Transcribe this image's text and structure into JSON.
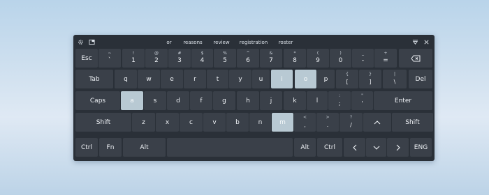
{
  "suggestions": [
    "or",
    "reasons",
    "review",
    "registration",
    "roster"
  ],
  "icons": [
    "settings-icon",
    "keyboard-layout-icon",
    "dock-icon",
    "close-icon",
    "backspace-icon",
    "arrow-up-icon",
    "arrow-left-icon",
    "arrow-down-icon",
    "arrow-right-icon"
  ],
  "colors": {
    "keyboard_bg": "#2a3038",
    "key": "#3a4049",
    "highlight": "#b8c9d3"
  },
  "rows": [
    [
      {
        "label": "Esc"
      },
      {
        "top": "~",
        "bottom": "`"
      },
      {
        "top": "!",
        "bottom": "1"
      },
      {
        "top": "@",
        "bottom": "2"
      },
      {
        "top": "#",
        "bottom": "3"
      },
      {
        "top": "$",
        "bottom": "4"
      },
      {
        "top": "%",
        "bottom": "5"
      },
      {
        "top": "^",
        "bottom": "6"
      },
      {
        "top": "&",
        "bottom": "7"
      },
      {
        "top": "*",
        "bottom": "8"
      },
      {
        "top": "(",
        "bottom": "9"
      },
      {
        "top": ")",
        "bottom": "0"
      },
      {
        "top": "_",
        "bottom": "-"
      },
      {
        "top": "+",
        "bottom": "="
      },
      {
        "icon": "backspace-icon"
      }
    ],
    [
      {
        "label": "Tab"
      },
      {
        "label": "q"
      },
      {
        "label": "w"
      },
      {
        "label": "e"
      },
      {
        "label": "r"
      },
      {
        "label": "t"
      },
      {
        "label": "y"
      },
      {
        "label": "u"
      },
      {
        "label": "i",
        "highlighted": true
      },
      {
        "label": "o",
        "highlighted": true
      },
      {
        "label": "p"
      },
      {
        "top": "{",
        "bottom": "["
      },
      {
        "top": "}",
        "bottom": "]"
      },
      {
        "top": "|",
        "bottom": "\\"
      },
      {
        "label": "Del"
      }
    ],
    [
      {
        "label": "Caps"
      },
      {
        "label": "a",
        "highlighted": true
      },
      {
        "label": "s"
      },
      {
        "label": "d"
      },
      {
        "label": "f"
      },
      {
        "label": "g"
      },
      {
        "label": "h"
      },
      {
        "label": "j"
      },
      {
        "label": "k"
      },
      {
        "label": "l"
      },
      {
        "top": ":",
        "bottom": ";"
      },
      {
        "top": "\"",
        "bottom": "'"
      },
      {
        "label": "Enter"
      }
    ],
    [
      {
        "label": "Shift"
      },
      {
        "label": "z"
      },
      {
        "label": "x"
      },
      {
        "label": "c"
      },
      {
        "label": "v"
      },
      {
        "label": "b"
      },
      {
        "label": "n"
      },
      {
        "label": "m",
        "highlighted": true
      },
      {
        "top": "<",
        "bottom": ","
      },
      {
        "top": ">",
        "bottom": "."
      },
      {
        "top": "?",
        "bottom": "/"
      },
      {
        "icon": "arrow-up-icon"
      },
      {
        "label": "Shift"
      }
    ],
    [
      {
        "label": "Ctrl"
      },
      {
        "label": "Fn"
      },
      {
        "label": "Alt"
      },
      {
        "label": ""
      },
      {
        "label": "Alt"
      },
      {
        "label": "Ctrl"
      },
      {
        "icon": "arrow-left-icon"
      },
      {
        "icon": "arrow-down-icon"
      },
      {
        "icon": "arrow-right-icon"
      },
      {
        "label": "ENG"
      }
    ]
  ]
}
